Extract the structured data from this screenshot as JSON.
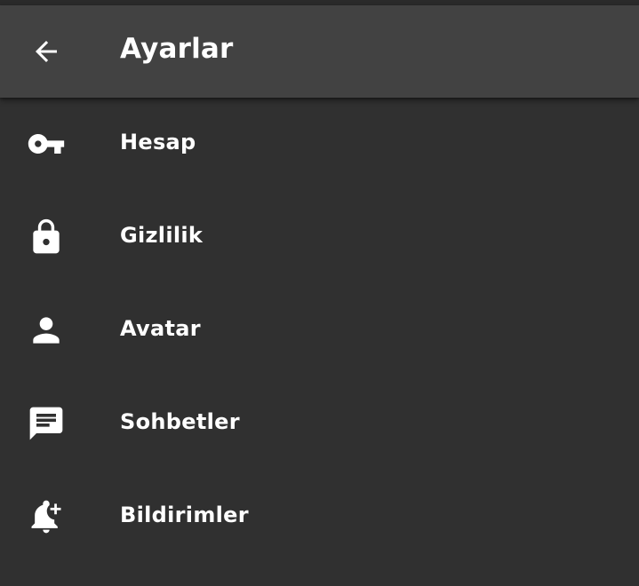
{
  "app_bar": {
    "title": "Ayarlar",
    "back_icon": "arrow-back-icon"
  },
  "menu": {
    "items": [
      {
        "label": "Hesap",
        "icon": "key-icon"
      },
      {
        "label": "Gizlilik",
        "icon": "lock-icon"
      },
      {
        "label": "Avatar",
        "icon": "person-icon"
      },
      {
        "label": "Sohbetler",
        "icon": "chat-icon"
      },
      {
        "label": "Bildirimler",
        "icon": "notification-add-icon"
      }
    ]
  },
  "colors": {
    "background": "#303030",
    "app_bar": "#424242",
    "text": "#ffffff"
  }
}
